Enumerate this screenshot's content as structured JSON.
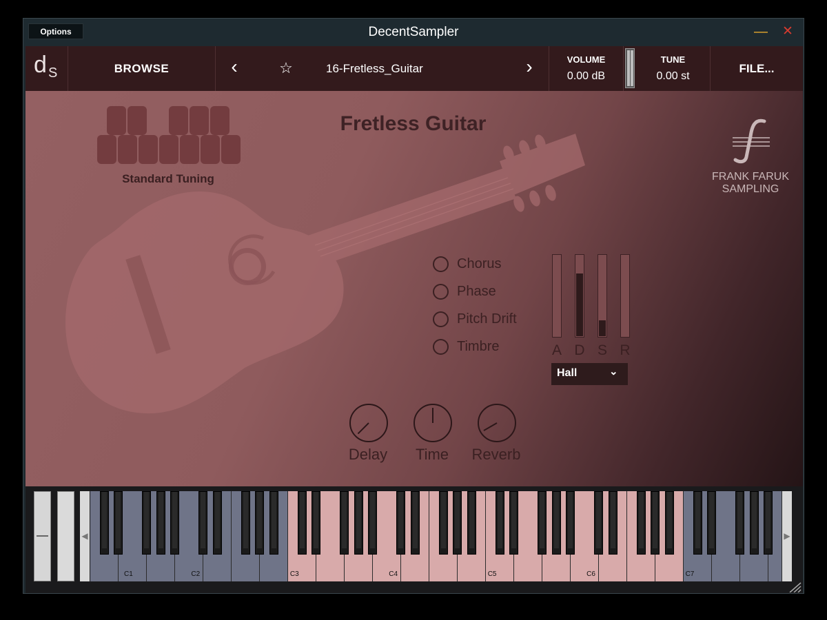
{
  "window": {
    "title": "DecentSampler",
    "options_label": "Options",
    "minimize_glyph": "—",
    "close_glyph": "✕"
  },
  "toolbar": {
    "logo": {
      "d": "d",
      "s": "S"
    },
    "browse_label": "BROWSE",
    "prev_glyph": "‹",
    "favorite_glyph": "☆",
    "next_glyph": "›",
    "preset_name": "16-Fretless_Guitar",
    "volume": {
      "label": "VOLUME",
      "value": "0.00 dB"
    },
    "tune": {
      "label": "TUNE",
      "value": "0.00 st"
    },
    "file_label": "FILE..."
  },
  "instrument": {
    "title": "Fretless Guitar",
    "tuning_label": "Standard Tuning",
    "brand": {
      "line1": "FRANK FARUK",
      "line2": "SAMPLING",
      "logo_icon": "f-hole-icon"
    },
    "options": [
      {
        "label": "Chorus",
        "checked": false
      },
      {
        "label": "Phase",
        "checked": false
      },
      {
        "label": "Pitch Drift",
        "checked": false
      },
      {
        "label": "Timbre",
        "checked": false
      }
    ],
    "adsr": [
      {
        "label": "A",
        "level": 0.0
      },
      {
        "label": "D",
        "level": 0.78
      },
      {
        "label": "S",
        "level": 0.2
      },
      {
        "label": "R",
        "level": 0.0
      }
    ],
    "reverb_type": {
      "value": "Hall",
      "chevron": "⌄"
    },
    "knobs": [
      {
        "label": "Delay",
        "angle": -135
      },
      {
        "label": "Time",
        "angle": 0
      },
      {
        "label": "Reverb",
        "angle": -120
      }
    ]
  },
  "keyboard": {
    "octave_labels": [
      "C1",
      "C2",
      "C3",
      "C4",
      "C5",
      "C6",
      "C7"
    ],
    "scroll_left_glyph": "◀",
    "scroll_right_glyph": "▶",
    "colors": {
      "out_of_range": "#6f7488",
      "in_range": "#d8aaaa"
    }
  },
  "colors": {
    "panel_dark": "#331a1c",
    "accent_text": "#3b2022",
    "titlebar": "#1e2a30"
  }
}
